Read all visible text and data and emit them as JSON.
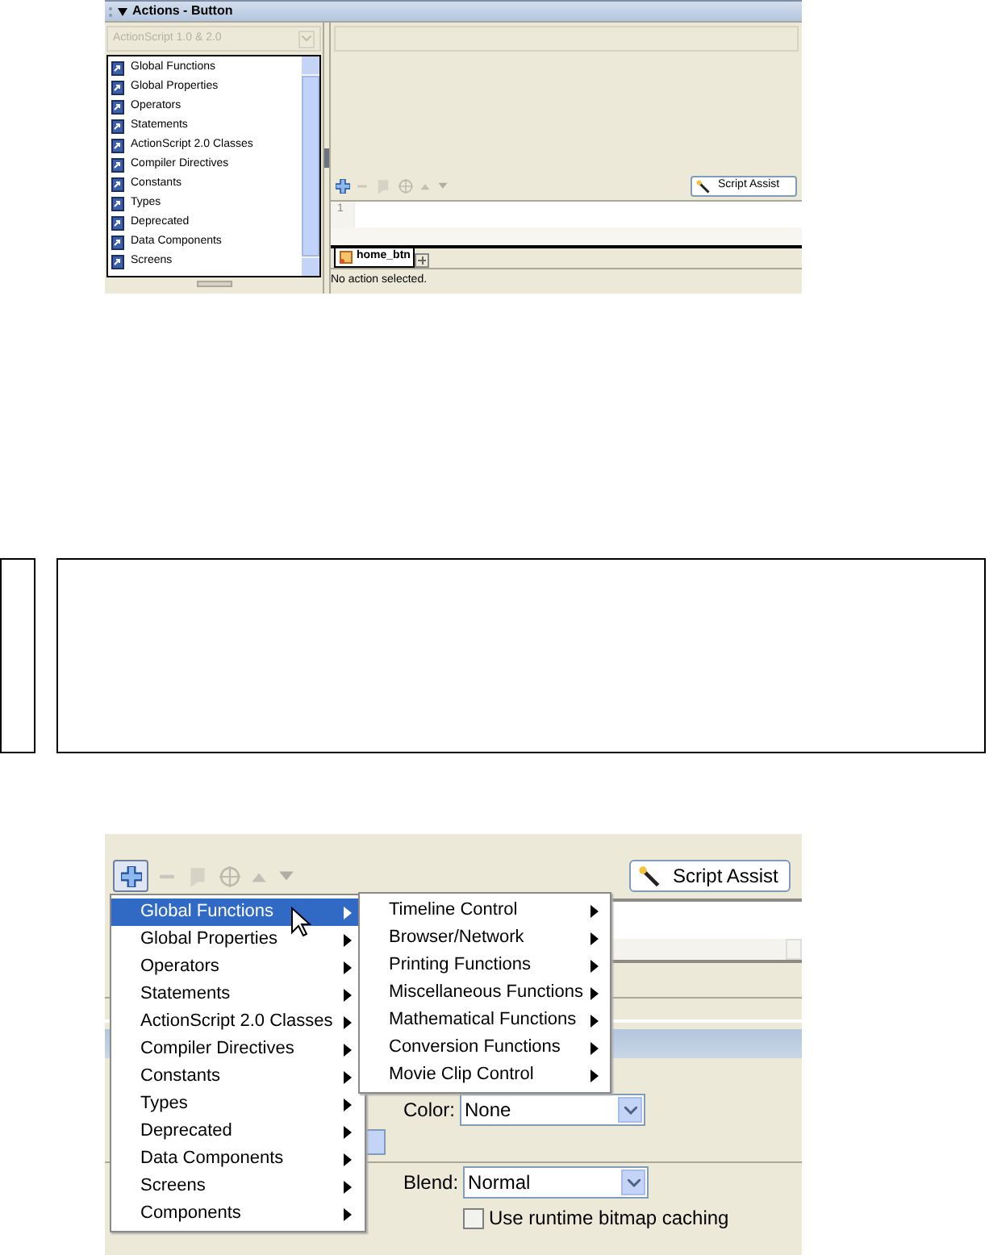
{
  "panel1": {
    "title": "Actions - Button",
    "version_select": {
      "value": "ActionScript 1.0 & 2.0",
      "disabled": true
    },
    "toolbox_items": [
      "Global Functions",
      "Global Properties",
      "Operators",
      "Statements",
      "ActionScript 2.0 Classes",
      "Compiler Directives",
      "Constants",
      "Types",
      "Deprecated",
      "Data Components",
      "Screens"
    ],
    "line_numbers": [
      "1"
    ],
    "script_assist": "Script Assist",
    "script_tab": "home_btn",
    "status": "No action selected."
  },
  "panel2": {
    "script_assist": "Script Assist",
    "menu": [
      {
        "label": "Global Functions",
        "selected": true
      },
      {
        "label": "Global Properties",
        "selected": false
      },
      {
        "label": "Operators",
        "selected": false
      },
      {
        "label": "Statements",
        "selected": false
      },
      {
        "label": "ActionScript 2.0 Classes",
        "selected": false
      },
      {
        "label": "Compiler Directives",
        "selected": false
      },
      {
        "label": "Constants",
        "selected": false
      },
      {
        "label": "Types",
        "selected": false
      },
      {
        "label": "Deprecated",
        "selected": false
      },
      {
        "label": "Data Components",
        "selected": false
      },
      {
        "label": "Screens",
        "selected": false
      },
      {
        "label": "Components",
        "selected": false
      }
    ],
    "submenu": [
      "Timeline Control",
      "Browser/Network",
      "Printing Functions",
      "Miscellaneous Functions",
      "Mathematical Functions",
      "Conversion Functions",
      "Movie Clip Control"
    ],
    "color_label": "Color:",
    "color_value": "None",
    "blend_label": "Blend:",
    "blend_value": "Normal",
    "bitmap_caching": {
      "label": "Use runtime bitmap caching",
      "checked": false
    }
  }
}
